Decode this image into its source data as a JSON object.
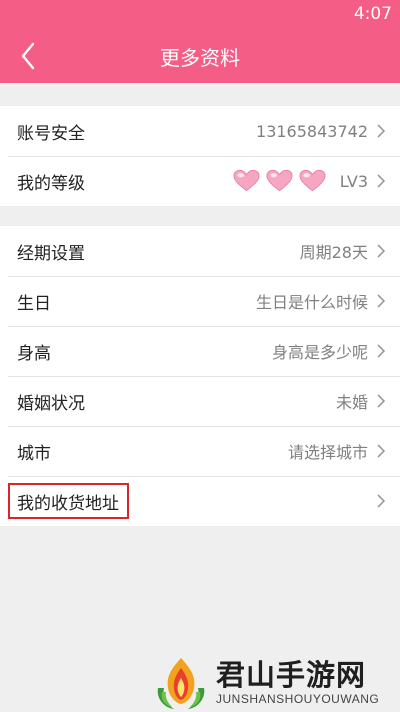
{
  "status_bar": {
    "time": "4:07"
  },
  "app_bar": {
    "title": "更多资料"
  },
  "account_section": [
    {
      "label": "账号安全",
      "value": "13165843742"
    },
    {
      "label": "我的等级",
      "value": "LV3",
      "hearts": 3
    }
  ],
  "profile_section": [
    {
      "label": "经期设置",
      "value": "周期28天"
    },
    {
      "label": "生日",
      "value": "生日是什么时候"
    },
    {
      "label": "身高",
      "value": "身高是多少呢"
    },
    {
      "label": "婚姻状况",
      "value": "未婚"
    },
    {
      "label": "城市",
      "value": "请选择城市"
    },
    {
      "label": "我的收货地址",
      "value": ""
    }
  ],
  "watermark": {
    "name": "君山手游网",
    "sub": "JUNSHANSHOUYOUWANG"
  },
  "colors": {
    "accent": "#f45d85",
    "highlight_box": "#d9262b",
    "heart": "#f49ab8"
  }
}
